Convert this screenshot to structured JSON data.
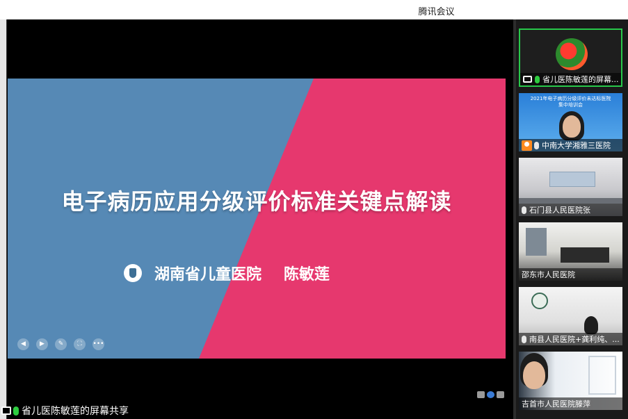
{
  "window": {
    "title": "腾讯会议"
  },
  "slide": {
    "title": "电子病历应用分级评价标准关键点解读",
    "organization": "湖南省儿童医院",
    "author": "陈敏莲",
    "colors": {
      "left": "#5689b5",
      "right": "#e6386e"
    }
  },
  "slide_tools": [
    {
      "name": "prev",
      "icon": "left-arrow-icon",
      "glyph": "◀"
    },
    {
      "name": "next",
      "icon": "right-arrow-icon",
      "glyph": "▶"
    },
    {
      "name": "pen",
      "icon": "pen-icon",
      "glyph": "✎"
    },
    {
      "name": "fullscreen",
      "icon": "fullscreen-icon",
      "glyph": "⛶"
    },
    {
      "name": "more",
      "icon": "more-icon",
      "glyph": "•••"
    }
  ],
  "share_status": {
    "text": "省儿医陈敏莲的屏幕共享"
  },
  "participants": [
    {
      "name": "省儿医陈敏莲的屏幕...",
      "status": "sharing"
    },
    {
      "name": "中南大学湘雅三医院",
      "status": "host",
      "banner_line1": "2021年电子病历分级评价未达标医院",
      "banner_line2": "集中培训会"
    },
    {
      "name": "石门县人民医院张",
      "status": "muted"
    },
    {
      "name": "邵东市人民医院",
      "status": "none"
    },
    {
      "name": "南县人民医院+龚利纯、...",
      "status": "muted"
    },
    {
      "name": "吉首市人民医院滕萍",
      "status": "none"
    }
  ],
  "accent_color": "#28c84a"
}
